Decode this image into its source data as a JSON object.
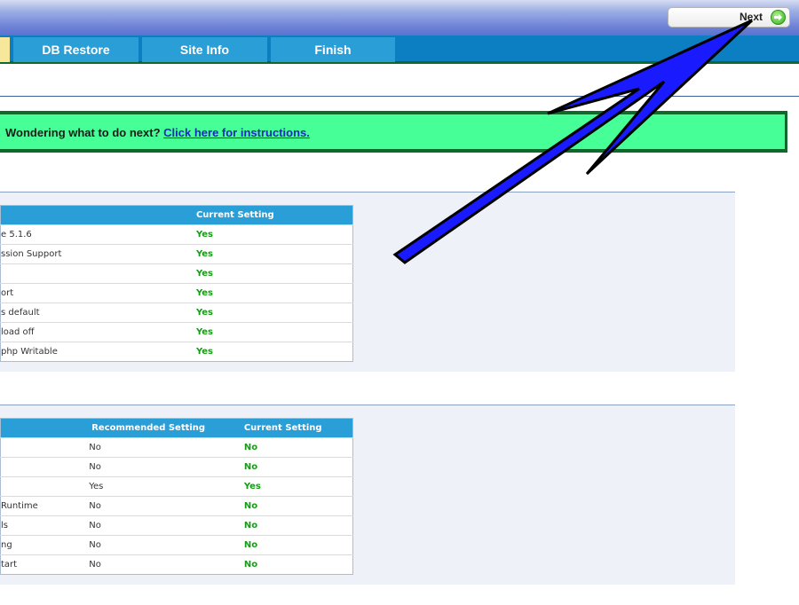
{
  "header": {
    "next_label": "Next"
  },
  "nav": {
    "tabs": [
      {
        "label": ""
      },
      {
        "label": "DB Restore"
      },
      {
        "label": "Site Info"
      },
      {
        "label": "Finish"
      }
    ]
  },
  "notice": {
    "text": "Wondering what to do next?",
    "link": "Click here for instructions."
  },
  "required_table": {
    "headers": [
      "",
      "Current Setting"
    ],
    "rows": [
      {
        "name": "e 5.1.6",
        "current": "Yes"
      },
      {
        "name": "ssion Support",
        "current": "Yes"
      },
      {
        "name": "",
        "current": "Yes"
      },
      {
        "name": "ort",
        "current": "Yes"
      },
      {
        "name": "s default",
        "current": "Yes"
      },
      {
        "name": "load off",
        "current": "Yes"
      },
      {
        "name": "php Writable",
        "current": "Yes"
      }
    ]
  },
  "recommended_table": {
    "headers": [
      "",
      "Recommended Setting",
      "Current Setting"
    ],
    "rows": [
      {
        "name": "",
        "recommended": "No",
        "current": "No"
      },
      {
        "name": "",
        "recommended": "No",
        "current": "No"
      },
      {
        "name": "",
        "recommended": "Yes",
        "current": "Yes"
      },
      {
        "name": "Runtime",
        "recommended": "No",
        "current": "No"
      },
      {
        "name": "ls",
        "recommended": "No",
        "current": "No"
      },
      {
        "name": "ng",
        "recommended": "No",
        "current": "No"
      },
      {
        "name": "tart",
        "recommended": "No",
        "current": "No"
      }
    ]
  },
  "colors": {
    "nav_bg": "#0b7fc1",
    "tab_bg": "#2a9ed6",
    "active_tab": "#f6e79a",
    "notice_bg": "#46ff96",
    "ok_green": "#1a9a1a",
    "arrow_blue": "#1a1aff"
  }
}
